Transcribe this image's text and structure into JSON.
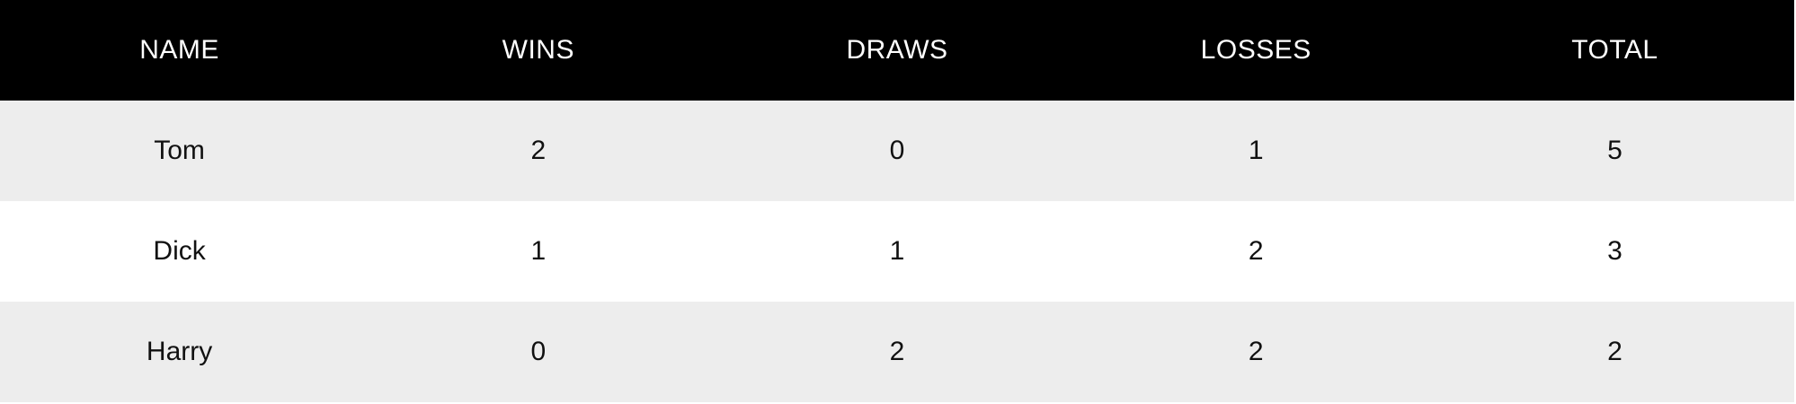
{
  "table": {
    "headers": [
      "NAME",
      "WINS",
      "DRAWS",
      "LOSSES",
      "TOTAL"
    ],
    "rows": [
      [
        "Tom",
        "2",
        "0",
        "1",
        "5"
      ],
      [
        "Dick",
        "1",
        "1",
        "2",
        "3"
      ],
      [
        "Harry",
        "0",
        "2",
        "2",
        "2"
      ]
    ]
  },
  "colors": {
    "header_bg": "#000000",
    "header_text": "#ffffff",
    "row_alt_bg": "#ededed",
    "row_bg": "#ffffff",
    "text": "#111111"
  }
}
